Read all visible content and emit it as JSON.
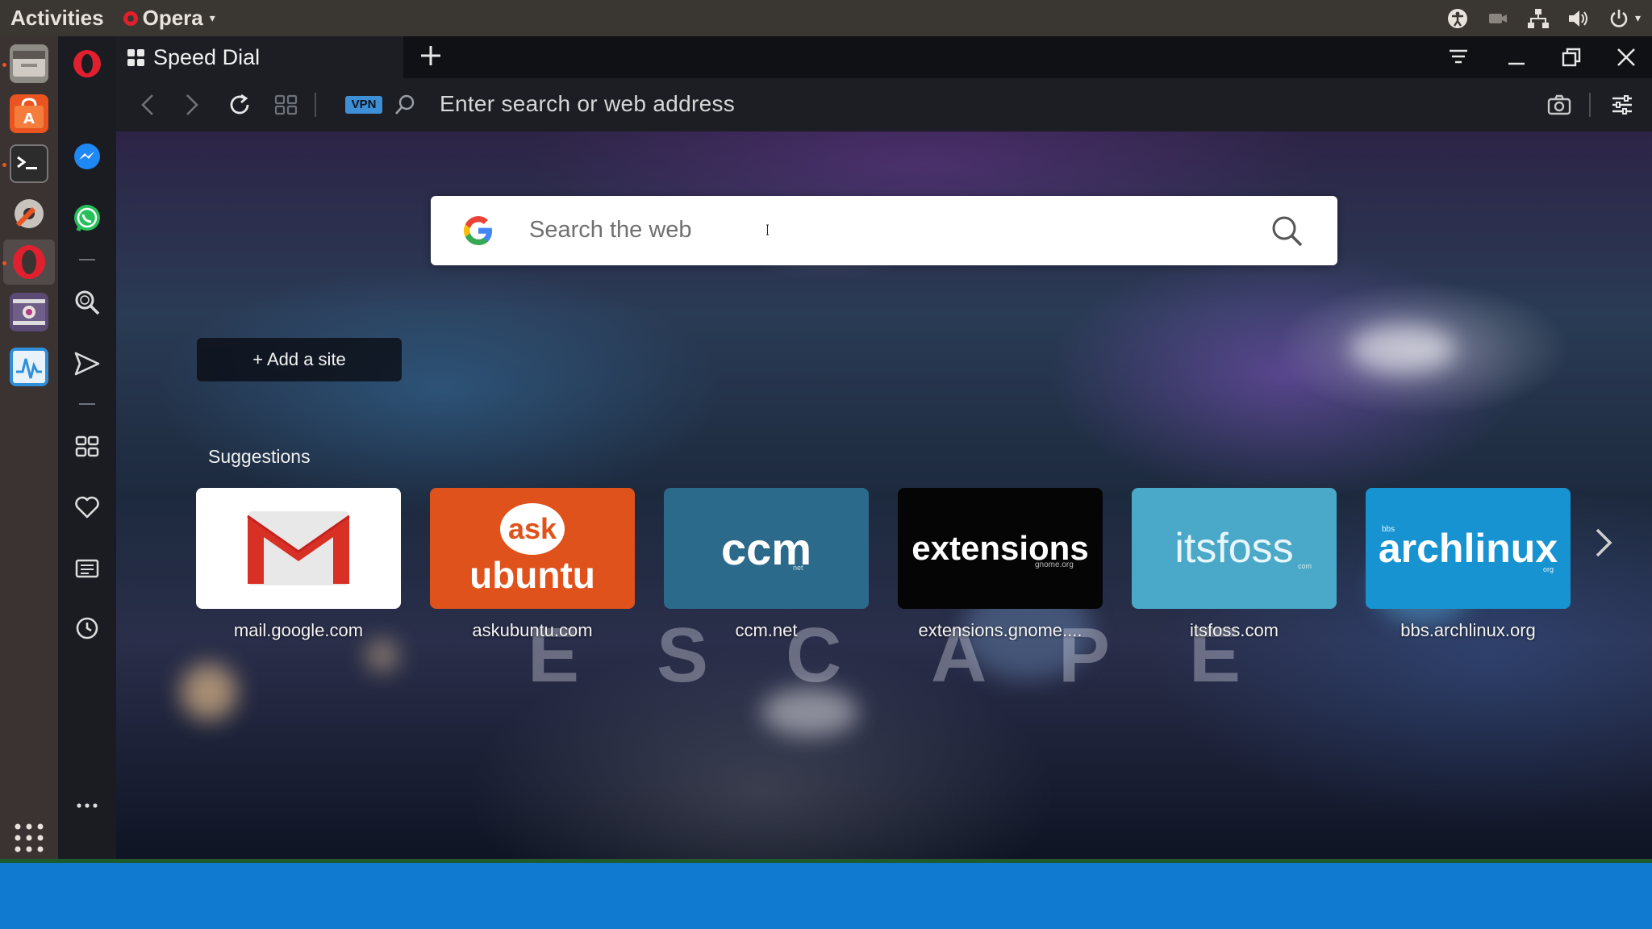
{
  "topbar": {
    "activities": "Activities",
    "app_name": "Opera"
  },
  "tab": {
    "title": "Speed Dial"
  },
  "addressbar": {
    "vpn": "VPN",
    "placeholder": "Enter search or web address"
  },
  "search": {
    "placeholder": "Search the web"
  },
  "speed_dial": {
    "add_site": "+ Add a site",
    "suggestions_label": "Suggestions",
    "tiles": [
      {
        "caption": "mail.google.com",
        "logo": "gmail-logo",
        "bg": "#ffffff"
      },
      {
        "caption": "askubuntu.com",
        "logo_top": "ask",
        "logo_bottom": "ubuntu",
        "bg": "#e0521b"
      },
      {
        "caption": "ccm.net",
        "logo": "ccm",
        "sub": "net",
        "bg": "#2b6a8a"
      },
      {
        "caption": "extensions.gnome....",
        "logo": "extensions",
        "sub": "gnome.org",
        "bg": "#050505"
      },
      {
        "caption": "itsfoss.com",
        "logo": "itsfoss",
        "sub": "com",
        "bg": "#4aa8c8"
      },
      {
        "caption": "bbs.archlinux.org",
        "logo": "archlinux",
        "pre": "bbs",
        "sub": "org",
        "bg": "#1793d1"
      }
    ]
  },
  "background_text": [
    "E",
    "S",
    "C",
    "A",
    "P",
    "E"
  ],
  "colors": {
    "opera_red": "#e0202e",
    "vpn_blue": "#3d8fd6",
    "bottom_blue": "#0f7ad0"
  }
}
